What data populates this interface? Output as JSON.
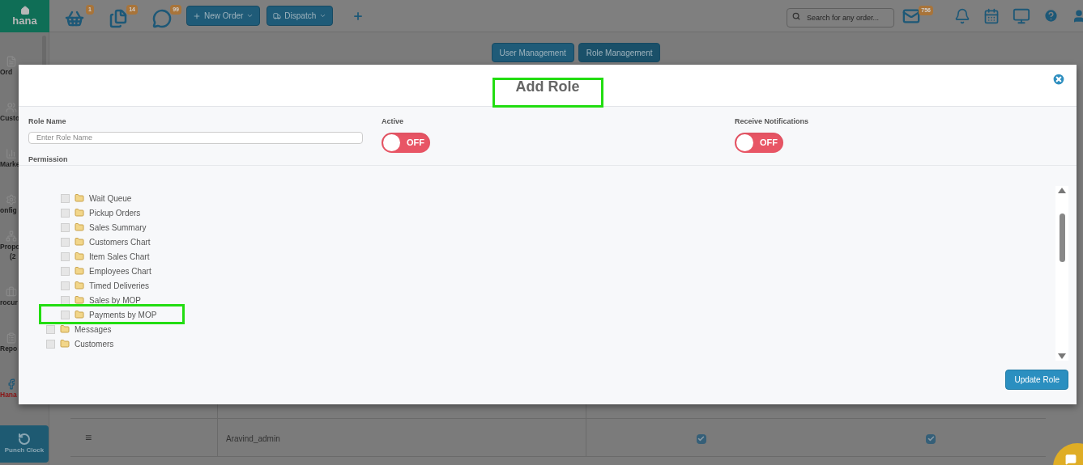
{
  "brand": {
    "logo_text": "hana"
  },
  "top_bar": {
    "counters": [
      {
        "kind": "basket",
        "badge": "1"
      },
      {
        "kind": "documents",
        "badge": "14"
      },
      {
        "kind": "chat",
        "badge": "99"
      }
    ],
    "buttons": [
      {
        "kind": "new",
        "label": "New Order"
      },
      {
        "kind": "dispatch",
        "label": "Dispatch"
      }
    ],
    "search": {
      "placeholder": "Search for any order..."
    },
    "mail_badge": "756"
  },
  "sidebar": {
    "items": [
      {
        "kind": "orders",
        "label": "Ord"
      },
      {
        "kind": "customers",
        "label": "Custo"
      },
      {
        "kind": "marketing",
        "label": "Marke"
      },
      {
        "kind": "config",
        "label": "onfig"
      },
      {
        "kind": "proposals",
        "label": "Propo",
        "label_2": "(2"
      },
      {
        "kind": "procurement",
        "label": "rocur"
      },
      {
        "kind": "reports",
        "label": "Repo"
      },
      {
        "kind": "brand",
        "label": "Hana"
      }
    ],
    "punch_clock": "Punch Clock"
  },
  "page_tabs": [
    {
      "label": "User Management",
      "selected": false
    },
    {
      "label": "Role Management",
      "selected": true
    }
  ],
  "table": {
    "rows": [
      {
        "handle": "≡",
        "name": "Aravind_admin",
        "col_3_checked": true,
        "col_4_checked": true
      }
    ]
  },
  "modal": {
    "title": {
      "text": "Add Role",
      "highlighted": true
    },
    "role_name": {
      "label": "Role Name",
      "placeholder": "Enter Role Name"
    },
    "active": {
      "label": "Active",
      "on": false,
      "text": "OFF"
    },
    "notifications": {
      "label": "Receive Notifications",
      "on": false,
      "text": "OFF"
    },
    "permission_label": "Permission",
    "tree": [
      {
        "children": [
          {
            "label": "Wait Queue",
            "checked": false,
            "highlighted": false
          },
          {
            "label": "Pickup Orders",
            "checked": false,
            "highlighted": false
          },
          {
            "label": "Sales Summary",
            "checked": false,
            "highlighted": false
          },
          {
            "label": "Customers Chart",
            "checked": false,
            "highlighted": false
          },
          {
            "label": "Item Sales Chart",
            "checked": false,
            "highlighted": false
          },
          {
            "label": "Employees Chart",
            "checked": false,
            "highlighted": false
          },
          {
            "label": "Timed Deliveries",
            "checked": false,
            "highlighted": false
          },
          {
            "label": "Sales by MOP",
            "checked": false,
            "highlighted": false
          },
          {
            "label": "Payments by MOP",
            "checked": false,
            "highlighted": true
          }
        ]
      },
      {
        "label": "Messages",
        "checked": false,
        "highlighted": false
      },
      {
        "label": "Customers",
        "checked": false,
        "highlighted": false
      }
    ],
    "submit": "Update Role"
  }
}
